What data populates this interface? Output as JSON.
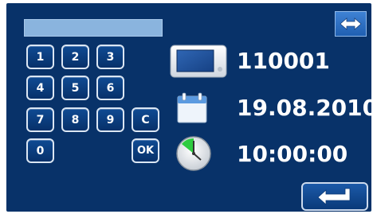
{
  "keypad": {
    "keys": [
      "1",
      "2",
      "3",
      "4",
      "5",
      "6",
      "7",
      "8",
      "9",
      "C",
      "0",
      "OK"
    ]
  },
  "input": {
    "value": ""
  },
  "info": {
    "device_id": "110001",
    "date": "19.08.2010",
    "time": "10:00:00"
  },
  "icons": {
    "swap": "swap-arrows-icon",
    "enter": "enter-return-icon",
    "device": "device-display-icon",
    "calendar": "calendar-icon",
    "clock": "clock-icon"
  },
  "colors": {
    "background": "#083269",
    "input_bar": "#8ab4de",
    "text": "#ffffff",
    "clock_accent": "#2ecc40"
  }
}
